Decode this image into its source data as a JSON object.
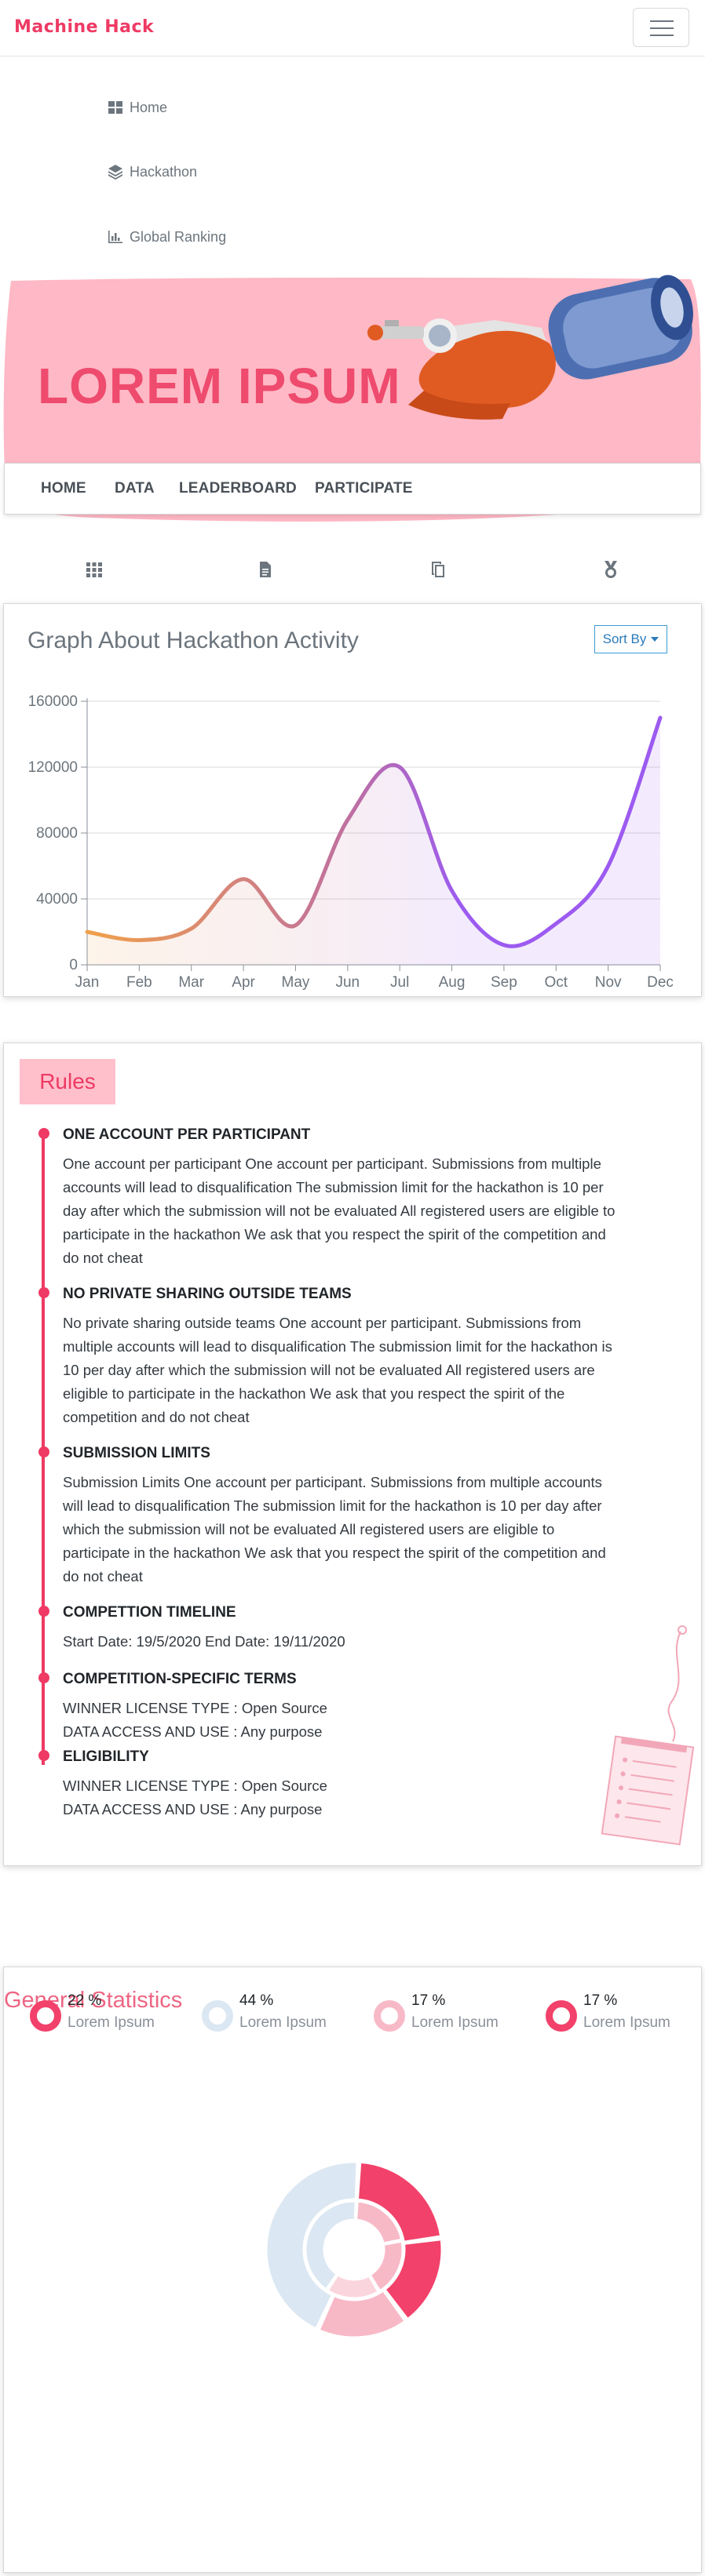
{
  "brand": "Machine Hack",
  "nav": {
    "menu": [
      {
        "label": "Home",
        "icon": "dashboard-icon"
      },
      {
        "label": "Hackathon",
        "icon": "layers-icon"
      },
      {
        "label": "Global Ranking",
        "icon": "bar-chart-icon"
      }
    ]
  },
  "banner": {
    "title": "LOREM IPSUM",
    "tabs": [
      "HOME",
      "DATA",
      "LEADERBOARD",
      "PARTICIPATE"
    ]
  },
  "quick_icons": [
    "grid-icon",
    "file-icon",
    "copy-icon",
    "medal-icon"
  ],
  "graph": {
    "title": "Graph About Hackathon Activity",
    "sort_label": "Sort By"
  },
  "chart_data": {
    "type": "line",
    "categories": [
      "Jan",
      "Feb",
      "Mar",
      "Apr",
      "May",
      "Jun",
      "Jul",
      "Aug",
      "Sep",
      "Oct",
      "Nov",
      "Dec"
    ],
    "values": [
      20000,
      15000,
      22000,
      52000,
      24000,
      88000,
      120000,
      45000,
      12000,
      25000,
      60000,
      150000
    ],
    "yticks": [
      "0",
      "40000",
      "80000",
      "120000",
      "160000"
    ],
    "ylim": [
      0,
      160000
    ],
    "grid": true,
    "colors": {
      "start": "#f0a04b",
      "middle": "#c0709e",
      "end": "#9c5bf0"
    }
  },
  "rules": {
    "tag": "Rules",
    "items": [
      {
        "title": "ONE ACCOUNT PER PARTICIPANT",
        "lines": [
          "One account per participant One account per participant. Submissions from multiple",
          "accounts will lead to disqualification The submission limit for the hackathon is 10 per",
          "day after which the submission will not be evaluated All registered users are eligible to",
          "participate in the hackathon We ask that you respect the spirit of the competition and",
          "do not cheat"
        ]
      },
      {
        "title": "NO PRIVATE SHARING OUTSIDE TEAMS",
        "lines": [
          "No private sharing outside teams One account per participant. Submissions from",
          "multiple accounts will lead to disqualification The submission limit for the hackathon is",
          "10 per day after which the submission will not be evaluated All registered users are",
          "eligible to participate in the hackathon We ask that you respect the spirit of the",
          "competition and do not cheat"
        ]
      },
      {
        "title": "SUBMISSION LIMITS",
        "lines": [
          "Submission Limits One account per participant. Submissions from multiple accounts",
          "will lead to disqualification The submission limit for the hackathon is 10 per day after",
          "which the submission will not be evaluated All registered users are eligible to",
          "participate in the hackathon We ask that you respect the spirit of the competition and",
          "do not cheat"
        ]
      },
      {
        "title": "COMPETTION TIMELINE",
        "lines": [
          "Start Date: 19/5/2020 End Date: 19/11/2020"
        ]
      },
      {
        "title": "COMPETITION-SPECIFIC TERMS",
        "lines": [
          "WINNER LICENSE TYPE : Open Source",
          "DATA ACCESS AND USE : Any purpose"
        ]
      },
      {
        "title": "ELIGIBILITY",
        "lines": [
          "WINNER LICENSE TYPE : Open Source",
          "DATA ACCESS AND USE : Any purpose"
        ]
      }
    ]
  },
  "stats": {
    "title": "General Statistics",
    "legend": [
      {
        "pct": "22 %",
        "label": "Lorem Ipsum",
        "color": "#f2416a"
      },
      {
        "pct": "44 %",
        "label": "Lorem Ipsum",
        "color": "#dbe7f2"
      },
      {
        "pct": "17 %",
        "label": "Lorem Ipsum",
        "color": "#f8b9c7"
      },
      {
        "pct": "17 %",
        "label": "Lorem Ipsum",
        "color": "#f2416a"
      }
    ],
    "colors": {
      "primary": "#f2416a",
      "light": "#dbe7f2",
      "pink": "#f8b9c7",
      "pale": "#fbd5dd"
    }
  }
}
